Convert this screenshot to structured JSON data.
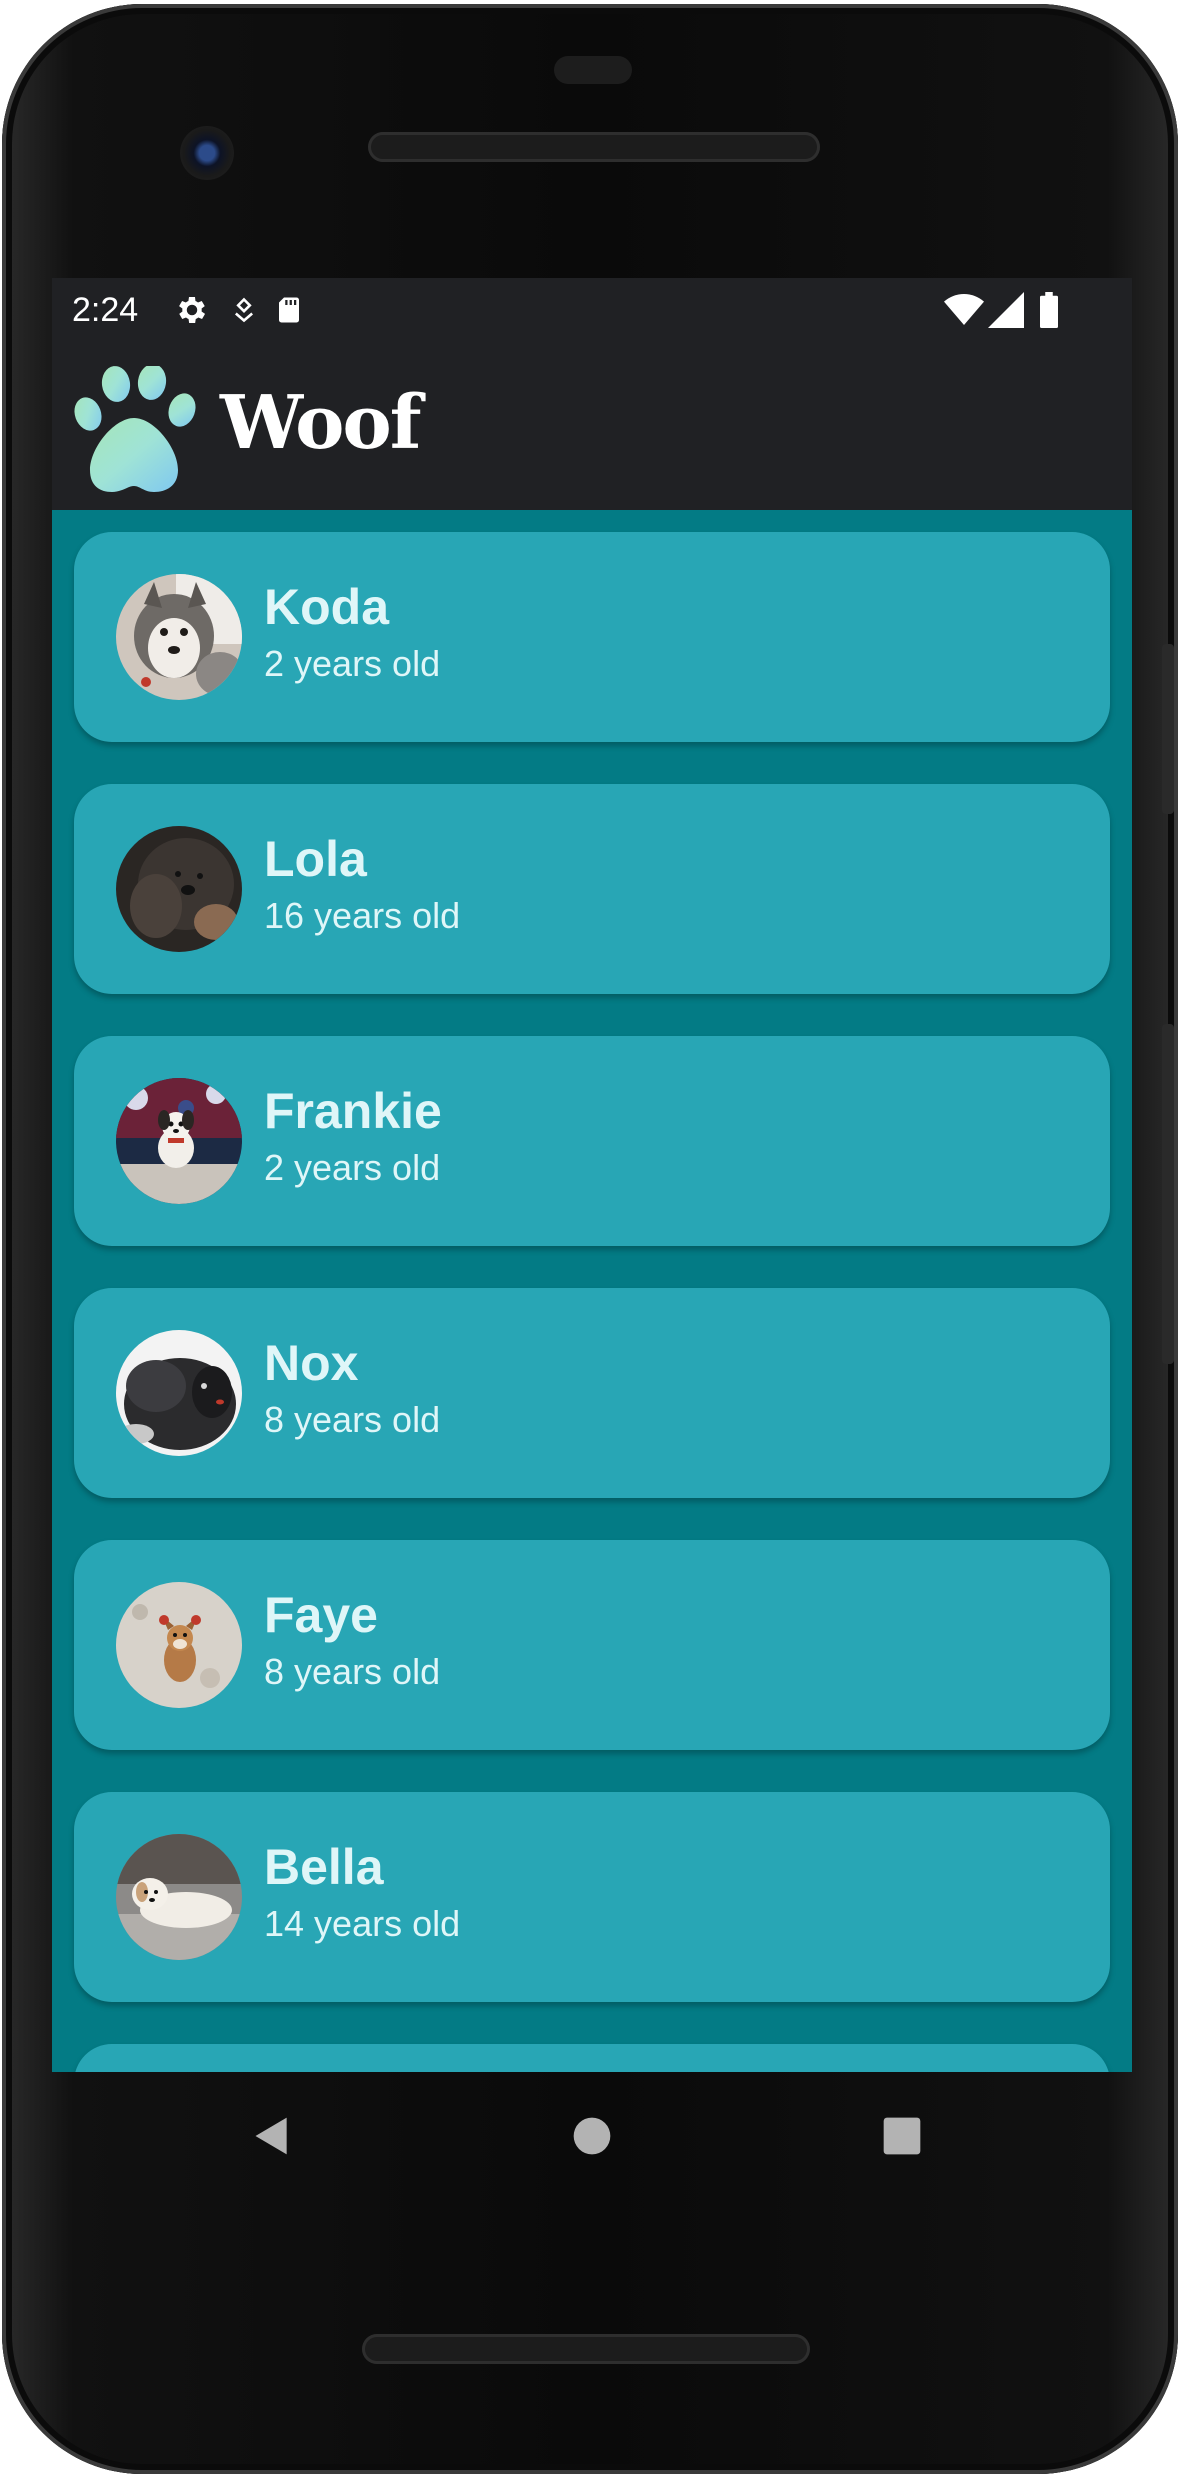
{
  "status_bar": {
    "time": "2:24",
    "left_icons": [
      "gear-icon",
      "location-pin-icon",
      "sd-card-icon"
    ],
    "right_icons": [
      "wifi-icon",
      "cellular-signal-icon",
      "battery-icon"
    ]
  },
  "app_bar": {
    "title": "Woof",
    "logo_icon": "paw-icon"
  },
  "dogs": [
    {
      "name": "Koda",
      "age": "2 years old",
      "photo": "koda-photo"
    },
    {
      "name": "Lola",
      "age": "16 years old",
      "photo": "lola-photo"
    },
    {
      "name": "Frankie",
      "age": "2 years old",
      "photo": "frankie-photo"
    },
    {
      "name": "Nox",
      "age": "8 years old",
      "photo": "nox-photo"
    },
    {
      "name": "Faye",
      "age": "8 years old",
      "photo": "faye-photo"
    },
    {
      "name": "Bella",
      "age": "14 years old",
      "photo": "bella-photo"
    }
  ],
  "nav_bar": {
    "buttons": [
      "back-icon",
      "home-icon",
      "recents-icon"
    ]
  },
  "colors": {
    "background": "#037B85",
    "card": "#28A6B5",
    "app_bar": "#202124",
    "text": "#DFF6F8"
  }
}
